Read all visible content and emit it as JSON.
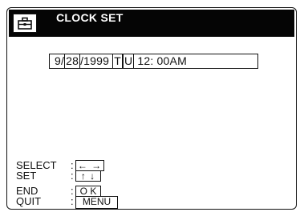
{
  "screen": {
    "title": "CLOCK SET",
    "icon": "toolbox-icon"
  },
  "clock": {
    "month": "9",
    "sep1": "/",
    "day": "28",
    "sep2": "/",
    "year": "1999",
    "weekday_t": "T",
    "weekday_u": "U",
    "time_hour": "12",
    "time_rest": ": 00AM"
  },
  "legend": {
    "select_label": "SELECT",
    "select_key": "← →",
    "set_label": "SET",
    "set_key": "↑ ↓",
    "end_label": "END",
    "end_key": "O K",
    "quit_label": "QUIT",
    "quit_key": "MENU",
    "colon": ":"
  }
}
